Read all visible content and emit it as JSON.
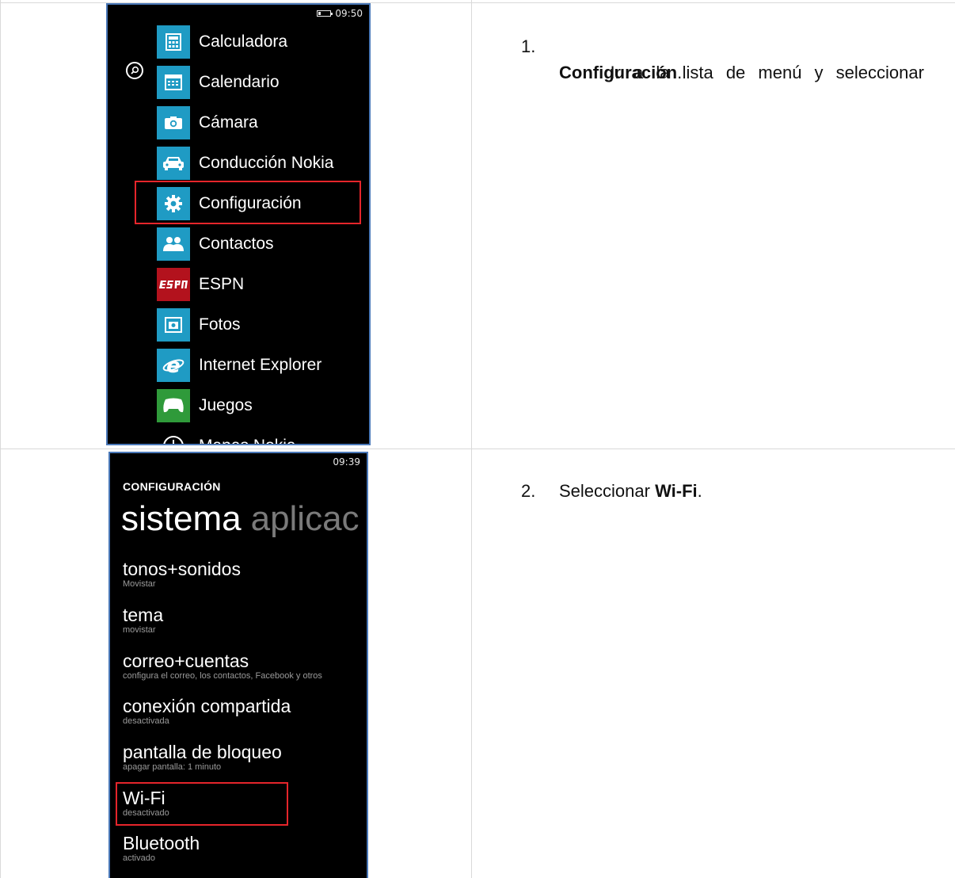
{
  "screen1": {
    "time": "09:50",
    "apps": [
      {
        "label": "Calculadora",
        "icon": "calculator-icon"
      },
      {
        "label": "Calendario",
        "icon": "calendar-icon"
      },
      {
        "label": "Cámara",
        "icon": "camera-icon"
      },
      {
        "label": "Conducción Nokia",
        "icon": "car-icon"
      },
      {
        "label": "Configuración",
        "icon": "gear-icon"
      },
      {
        "label": "Contactos",
        "icon": "people-icon"
      },
      {
        "label": "ESPN",
        "icon": "espn-icon"
      },
      {
        "label": "Fotos",
        "icon": "photos-icon"
      },
      {
        "label": "Internet Explorer",
        "icon": "internet-explorer-icon"
      },
      {
        "label": "Juegos",
        "icon": "xbox-games-icon"
      },
      {
        "label": "Mapas Nokia",
        "icon": "maps-icon"
      }
    ],
    "highlighted": "Configuración"
  },
  "screen2": {
    "time": "09:39",
    "header": "CONFIGURACIÓN",
    "pivot_active": "sistema",
    "pivot_next": "aplicac",
    "settings": [
      {
        "title": "tonos+sonidos",
        "sub": "Movistar"
      },
      {
        "title": "tema",
        "sub": "movistar"
      },
      {
        "title": "correo+cuentas",
        "sub": "configura el correo, los contactos, Facebook y otros"
      },
      {
        "title": "conexión compartida",
        "sub": "desactivada"
      },
      {
        "title": "pantalla de bloqueo",
        "sub": "apagar pantalla: 1 minuto"
      },
      {
        "title": "Wi-Fi",
        "sub": "desactivado"
      },
      {
        "title": "Bluetooth",
        "sub": "activado"
      }
    ],
    "highlighted": "Wi-Fi"
  },
  "steps": [
    {
      "number": "1.",
      "line1": "Ir a la lista de menú y seleccionar",
      "bold": "Configuración",
      "after": "."
    },
    {
      "number": "2.",
      "before": "Seleccionar ",
      "bold": "Wi-Fi",
      "after": "."
    }
  ],
  "colors": {
    "tile": "#1f9bc4",
    "highlight": "#e5252b",
    "espn": "#b3121d",
    "games": "#2f9a3a"
  }
}
